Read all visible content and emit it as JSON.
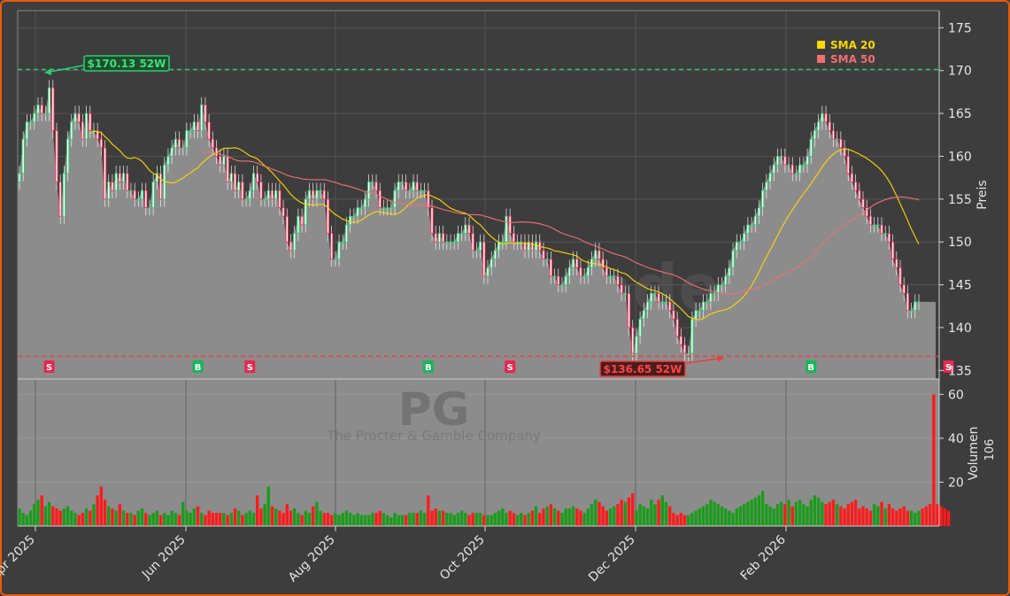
{
  "chart_data": {
    "type": "candlestick",
    "ticker": "PG",
    "company": "The Procter & Gamble Company",
    "watermark": "forexsignale.trade",
    "price_axis_label": "Preis",
    "volume_axis_label": "Volumen",
    "volume_unit": "10^6",
    "price_ylim": [
      134,
      177
    ],
    "price_ticks": [
      135,
      140,
      145,
      150,
      155,
      160,
      165,
      170,
      175
    ],
    "volume_ylim": [
      0,
      67
    ],
    "volume_ticks": [
      20,
      40,
      60
    ],
    "x_ticks": [
      "Apr 2025",
      "Jun 2025",
      "Aug 2025",
      "Oct 2025",
      "Dec 2025",
      "Feb 2026"
    ],
    "high_52w": {
      "value": 170.13,
      "label": "$170.13 52W"
    },
    "low_52w": {
      "value": 136.65,
      "label": "$136.65 52W"
    },
    "legend": [
      {
        "name": "SMA 20",
        "color": "#ffd700"
      },
      {
        "name": "SMA 50",
        "color": "#f07070"
      }
    ],
    "colors": {
      "up": "#2ecc71",
      "down": "#ff2d55",
      "vol_up": "#1a9c1a",
      "vol_down": "#ff1a1a",
      "area": "#8c8c8c",
      "high_line": "#2ecc71",
      "low_line": "#e84040"
    },
    "signals": [
      {
        "label": "S",
        "type": "sell",
        "index": 8
      },
      {
        "label": "B",
        "type": "buy",
        "index": 48
      },
      {
        "label": "S",
        "type": "sell",
        "index": 62
      },
      {
        "label": "B",
        "type": "buy",
        "index": 110
      },
      {
        "label": "S",
        "type": "sell",
        "index": 132
      },
      {
        "label": "B",
        "type": "buy",
        "index": 213
      },
      {
        "label": "S",
        "type": "sell",
        "index": 250
      }
    ],
    "close": [
      158,
      162,
      164,
      164,
      165,
      166,
      165,
      165,
      168,
      163,
      157,
      153,
      158,
      162,
      164,
      165,
      164,
      162,
      165,
      163,
      163,
      162,
      161,
      155,
      157,
      156,
      158,
      157,
      158,
      156,
      156,
      155,
      155,
      156,
      154,
      154,
      157,
      158,
      155,
      159,
      160,
      161,
      162,
      161,
      161,
      163,
      163,
      164,
      163,
      166,
      164,
      162,
      161,
      160,
      159,
      160,
      157,
      158,
      156,
      157,
      155,
      155,
      156,
      158,
      157,
      155,
      155,
      156,
      155,
      156,
      154,
      153,
      150,
      149,
      151,
      153,
      152,
      155,
      156,
      155,
      156,
      156,
      155,
      151,
      148,
      148,
      150,
      150,
      152,
      153,
      153,
      154,
      154,
      155,
      157,
      157,
      156,
      154,
      154,
      154,
      154,
      156,
      157,
      157,
      156,
      156,
      157,
      156,
      156,
      156,
      154,
      151,
      150,
      151,
      150,
      150,
      150,
      150,
      151,
      151,
      152,
      151,
      149,
      149,
      150,
      146,
      147,
      148,
      149,
      150,
      150,
      153,
      151,
      150,
      150,
      150,
      149,
      150,
      149,
      150,
      149,
      148,
      148,
      146,
      146,
      145,
      145,
      146,
      147,
      148,
      147,
      146,
      146,
      147,
      148,
      149,
      148,
      147,
      146,
      146,
      146,
      145,
      144,
      144,
      140,
      137,
      139,
      141,
      142,
      143,
      144,
      144,
      143,
      143,
      143,
      142,
      141,
      139,
      138,
      137,
      137,
      141,
      142,
      142,
      143,
      143,
      144,
      144,
      145,
      145,
      146,
      147,
      149,
      150,
      150,
      151,
      152,
      152,
      153,
      154,
      156,
      157,
      158,
      159,
      160,
      160,
      159,
      159,
      158,
      158,
      159,
      159,
      160,
      162,
      163,
      164,
      165,
      164,
      163,
      162,
      162,
      161,
      160,
      158,
      157,
      156,
      155,
      154,
      153,
      152,
      152,
      152,
      151,
      151,
      150,
      148,
      147,
      145,
      144,
      142,
      142,
      143,
      143
    ],
    "volume": [
      8,
      6,
      5,
      7,
      10,
      12,
      14,
      9,
      11,
      9,
      8,
      7,
      8,
      9,
      7,
      6,
      5,
      6,
      8,
      7,
      10,
      14,
      18,
      12,
      9,
      8,
      7,
      10,
      7,
      6,
      6,
      5,
      7,
      8,
      6,
      5,
      6,
      7,
      5,
      6,
      5,
      7,
      6,
      5,
      11,
      7,
      6,
      8,
      9,
      6,
      5,
      7,
      6,
      6,
      6,
      6,
      5,
      6,
      8,
      7,
      5,
      6,
      7,
      6,
      14,
      8,
      10,
      18,
      9,
      8,
      7,
      6,
      10,
      7,
      8,
      6,
      5,
      7,
      6,
      9,
      11,
      7,
      6,
      6,
      5,
      6,
      5,
      6,
      7,
      6,
      5,
      6,
      5,
      5,
      5,
      6,
      6,
      7,
      6,
      5,
      4,
      6,
      5,
      5,
      5,
      6,
      6,
      6,
      7,
      6,
      14,
      7,
      8,
      7,
      7,
      6,
      6,
      5,
      6,
      7,
      6,
      5,
      6,
      6,
      6,
      5,
      5,
      5,
      6,
      7,
      8,
      6,
      7,
      6,
      5,
      6,
      5,
      6,
      7,
      9,
      6,
      8,
      9,
      10,
      8,
      7,
      6,
      8,
      8,
      9,
      8,
      7,
      6,
      8,
      10,
      12,
      11,
      9,
      7,
      8,
      9,
      10,
      12,
      11,
      13,
      15,
      7,
      10,
      9,
      8,
      12,
      10,
      12,
      14,
      11,
      9,
      6,
      5,
      6,
      5,
      5,
      6,
      7,
      8,
      9,
      10,
      12,
      11,
      10,
      9,
      8,
      7,
      6,
      8,
      9,
      10,
      11,
      12,
      13,
      14,
      16,
      10,
      9,
      8,
      10,
      11,
      10,
      12,
      9,
      11,
      12,
      10,
      9,
      12,
      14,
      13,
      11,
      10,
      11,
      12,
      10,
      9,
      8,
      10,
      11,
      12,
      8,
      9,
      8,
      7,
      10,
      9,
      11,
      8,
      10,
      8,
      7,
      8,
      9,
      7,
      7,
      6,
      7,
      8,
      9,
      10,
      60,
      10,
      9,
      8,
      7
    ]
  }
}
